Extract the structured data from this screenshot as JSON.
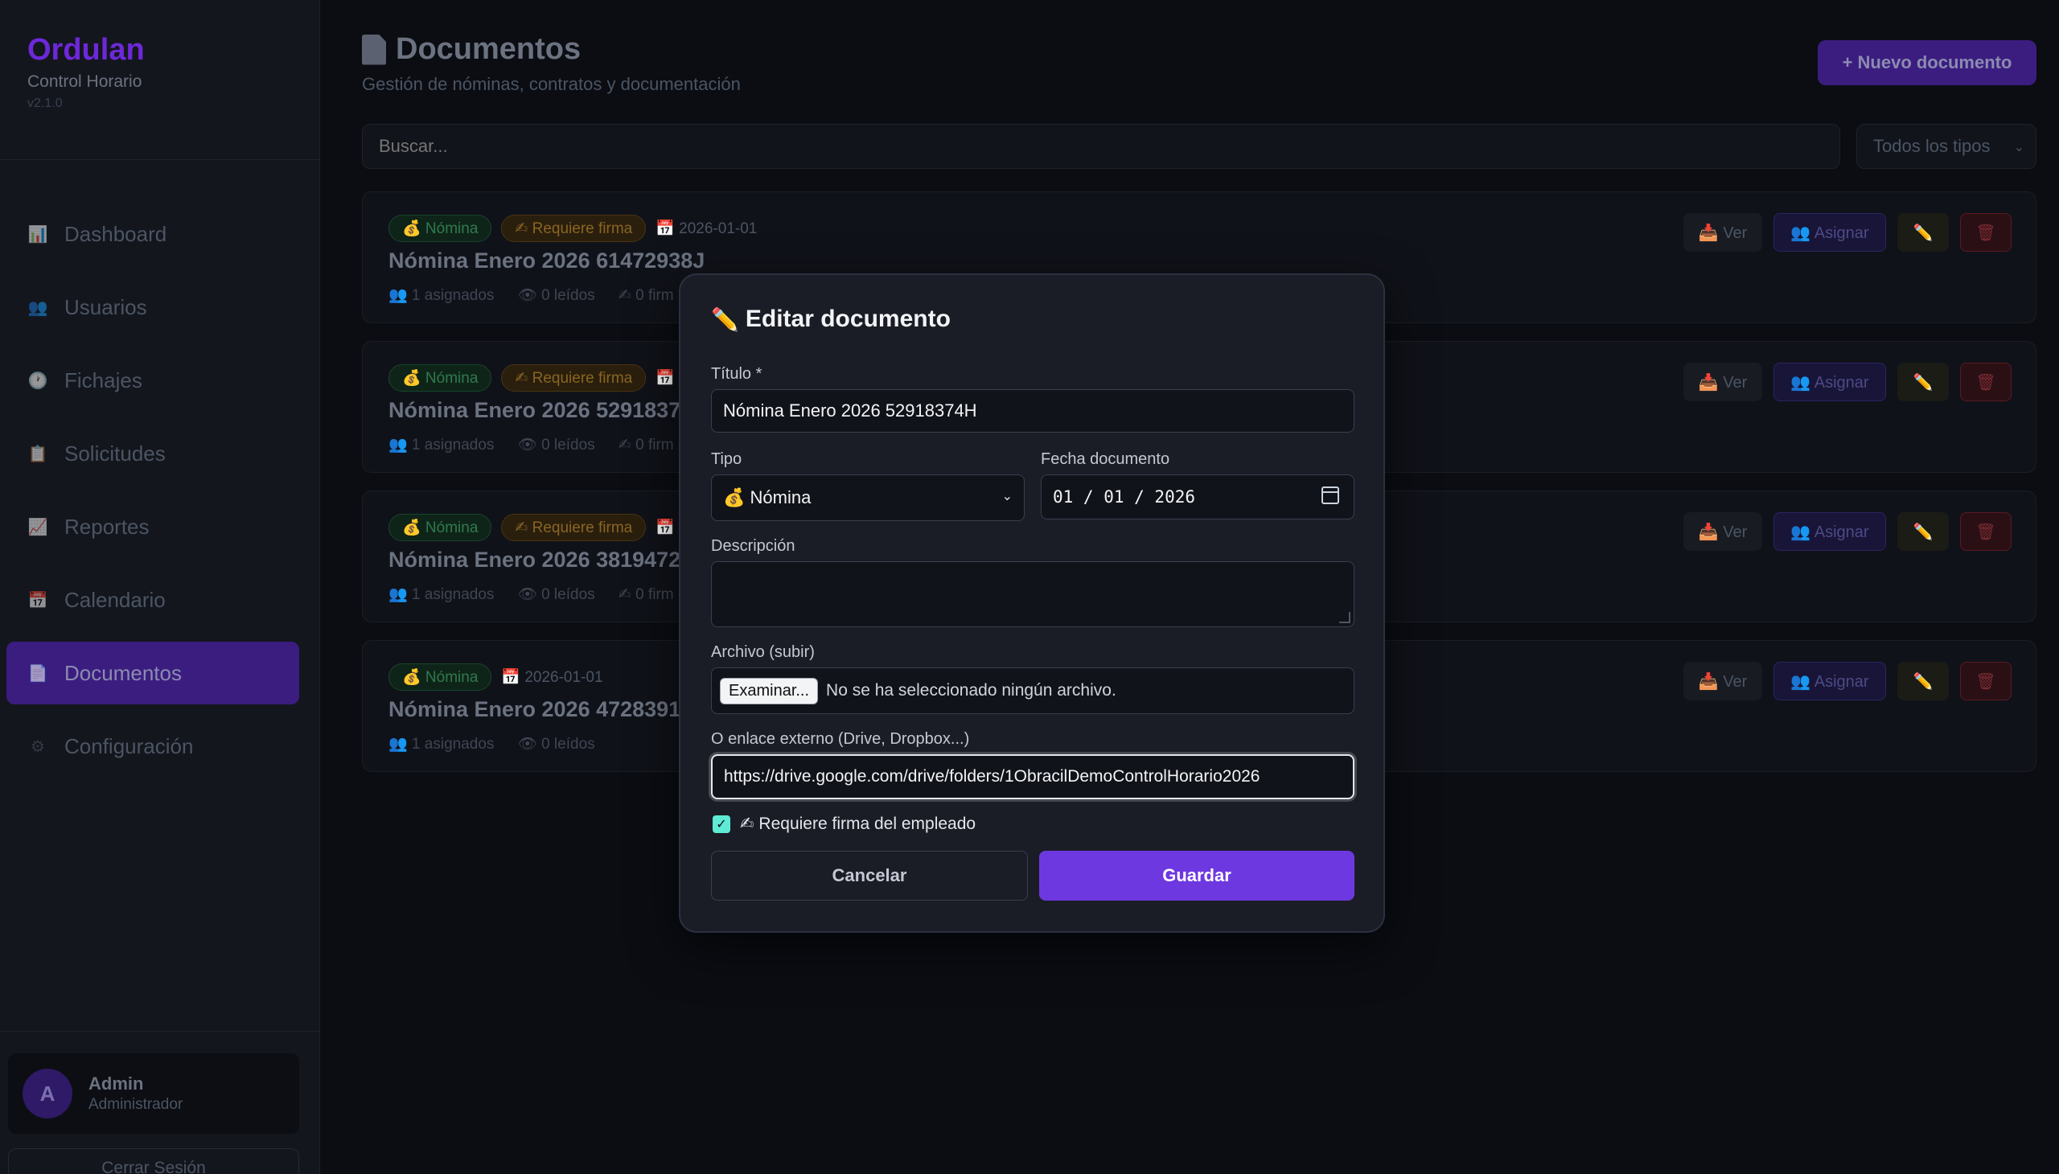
{
  "sidebar": {
    "brand": "Ordulan",
    "subtitle": "Control Horario",
    "version": "v2.1.0",
    "items": [
      {
        "label": "Dashboard",
        "icon": "chart-icon"
      },
      {
        "label": "Usuarios",
        "icon": "users-icon"
      },
      {
        "label": "Fichajes",
        "icon": "clock-icon"
      },
      {
        "label": "Solicitudes",
        "icon": "clipboard-icon"
      },
      {
        "label": "Reportes",
        "icon": "trend-icon"
      },
      {
        "label": "Calendario",
        "icon": "calendar-icon"
      },
      {
        "label": "Documentos",
        "icon": "document-icon",
        "active": true
      },
      {
        "label": "Configuración",
        "icon": "gear-icon"
      }
    ],
    "user": {
      "initial": "A",
      "name": "Admin",
      "role": "Administrador"
    },
    "logout": "Cerrar Sesión"
  },
  "header": {
    "title": "Documentos",
    "subtitle": "Gestión de nóminas, contratos y documentación",
    "new_button": "+ Nuevo documento"
  },
  "filters": {
    "search_placeholder": "Buscar...",
    "type_selected": "Todos los tipos"
  },
  "documents": [
    {
      "type": "💰 Nómina",
      "signature": "✍ Requiere firma",
      "date": "📅 2026-01-01",
      "title": "Nómina Enero 2026 61472938J",
      "assigned": "👥 1 asignados",
      "read": "👁 0 leídos",
      "signed": "✍ 0 firm"
    },
    {
      "type": "💰 Nómina",
      "signature": "✍ Requiere firma",
      "date": "📅",
      "title": "Nómina Enero 2026 5291837",
      "assigned": "👥 1 asignados",
      "read": "👁 0 leídos",
      "signed": "✍ 0 firm"
    },
    {
      "type": "💰 Nómina",
      "signature": "✍ Requiere firma",
      "date": "📅",
      "title": "Nómina Enero 2026 3819472",
      "assigned": "👥 1 asignados",
      "read": "👁 0 leídos",
      "signed": "✍ 0 firm"
    },
    {
      "type": "💰 Nómina",
      "signature": "",
      "date": "📅 2026-01-01",
      "title": "Nómina Enero 2026 4728391",
      "assigned": "👥 1 asignados",
      "read": "👁 0 leídos",
      "signed": ""
    }
  ],
  "card_actions": {
    "view": "📥 Ver",
    "assign": "👥 Asignar",
    "edit": "✏️",
    "delete": "🗑"
  },
  "modal": {
    "title": "Editar documento",
    "title_icon": "✏️",
    "title_label": "Título *",
    "title_value": "Nómina Enero 2026 52918374H",
    "type_label": "Tipo",
    "type_value": "💰 Nómina",
    "date_label": "Fecha documento",
    "date_value": "01 / 01 / 2026",
    "description_label": "Descripción",
    "description_value": "",
    "file_label": "Archivo (subir)",
    "file_button": "Examinar...",
    "file_status": "No se ha seleccionado ningún archivo.",
    "link_label": "O enlace externo (Drive, Dropbox...)",
    "link_value": "https://drive.google.com/drive/folders/1ObracilDemoControlHorario2026",
    "signature_checkbox_label": "✍ Requiere firma del empleado",
    "signature_checked": true,
    "cancel": "Cancelar",
    "save": "Guardar"
  },
  "colors": {
    "accent": "#6d38e0",
    "brand": "#6d28d9",
    "background": "#0b0d13",
    "modal_bg": "#1a1d26"
  }
}
